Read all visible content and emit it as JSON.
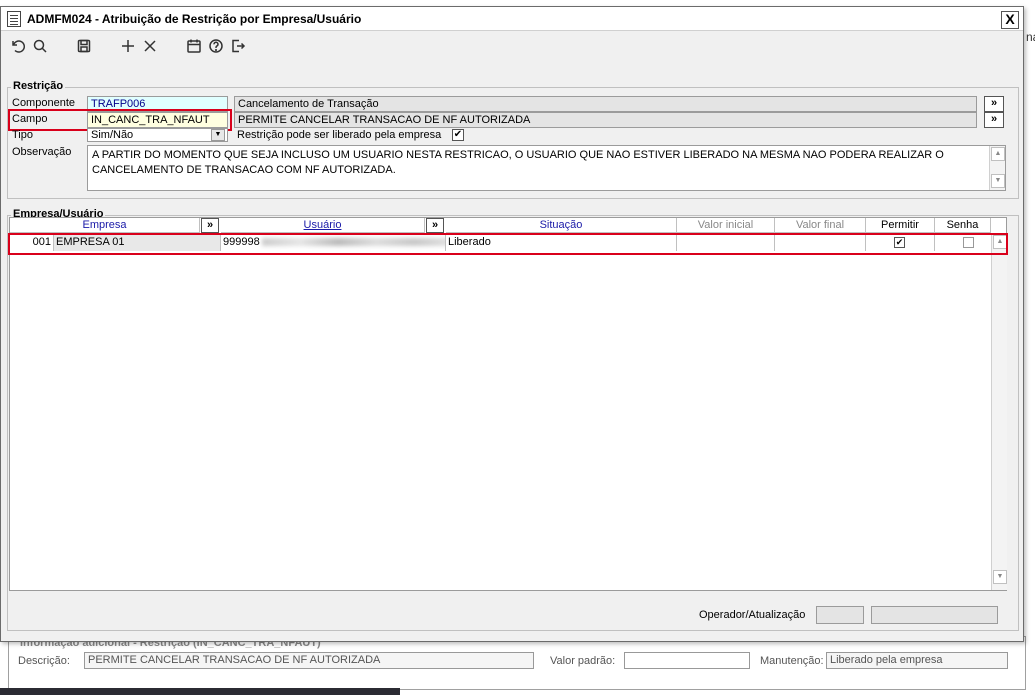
{
  "background": {
    "edge_text": "na",
    "additional_panel": {
      "legend": "Informação adicional - Restrição (IN_CANC_TRA_NFAUT)",
      "descricao_label": "Descrição:",
      "descricao_value": "PERMITE CANCELAR TRANSACAO DE NF AUTORIZADA",
      "valor_padrao_label": "Valor padrão:",
      "valor_padrao_value": "",
      "manutencao_label": "Manutenção:",
      "manutencao_value": "Liberado pela empresa"
    }
  },
  "window": {
    "title": "ADMFM024 - Atribuição de Restrição por Empresa/Usuário",
    "close_label": "X"
  },
  "toolbar": {
    "icons": [
      "undo-icon",
      "search-icon",
      "save-icon",
      "add-icon",
      "delete-icon",
      "calendar-icon",
      "help-icon",
      "exit-icon"
    ]
  },
  "restricao": {
    "group_title": "Restrição",
    "componente_label": "Componente",
    "componente_code": "TRAFP006",
    "componente_desc": "Cancelamento de Transação",
    "campo_label": "Campo",
    "campo_code": "IN_CANC_TRA_NFAUT",
    "campo_desc": "PERMITE CANCELAR TRANSACAO DE NF AUTORIZADA",
    "tipo_label": "Tipo",
    "tipo_value": "Sim/Não",
    "liberado_label": "Restrição pode ser liberado pela empresa",
    "liberado_checked": true,
    "observacao_label": "Observação",
    "observacao_text": "A PARTIR DO MOMENTO QUE SEJA INCLUSO UM USUARIO NESTA RESTRICAO, O USUARIO QUE NAO ESTIVER LIBERADO NA MESMA NAO PODERA REALIZAR O CANCELAMENTO DE TRANSACAO COM NF AUTORIZADA.",
    "more_button": "»"
  },
  "empresa_usuario": {
    "group_title": "Empresa/Usuário",
    "columns": {
      "empresa": "Empresa",
      "usuario": "Usuário",
      "situacao": "Situação",
      "valor_inicial": "Valor inicial",
      "valor_final": "Valor final",
      "permitir": "Permitir",
      "senha": "Senha"
    },
    "more_button": "»",
    "rows": [
      {
        "empresa_code": "001",
        "empresa_name": "EMPRESA 01",
        "usuario": "999998",
        "situacao": "Liberado",
        "valor_inicial": "",
        "valor_final": "",
        "permitir": true,
        "senha": false
      }
    ]
  },
  "footer": {
    "operador_label": "Operador/Atualização"
  }
}
